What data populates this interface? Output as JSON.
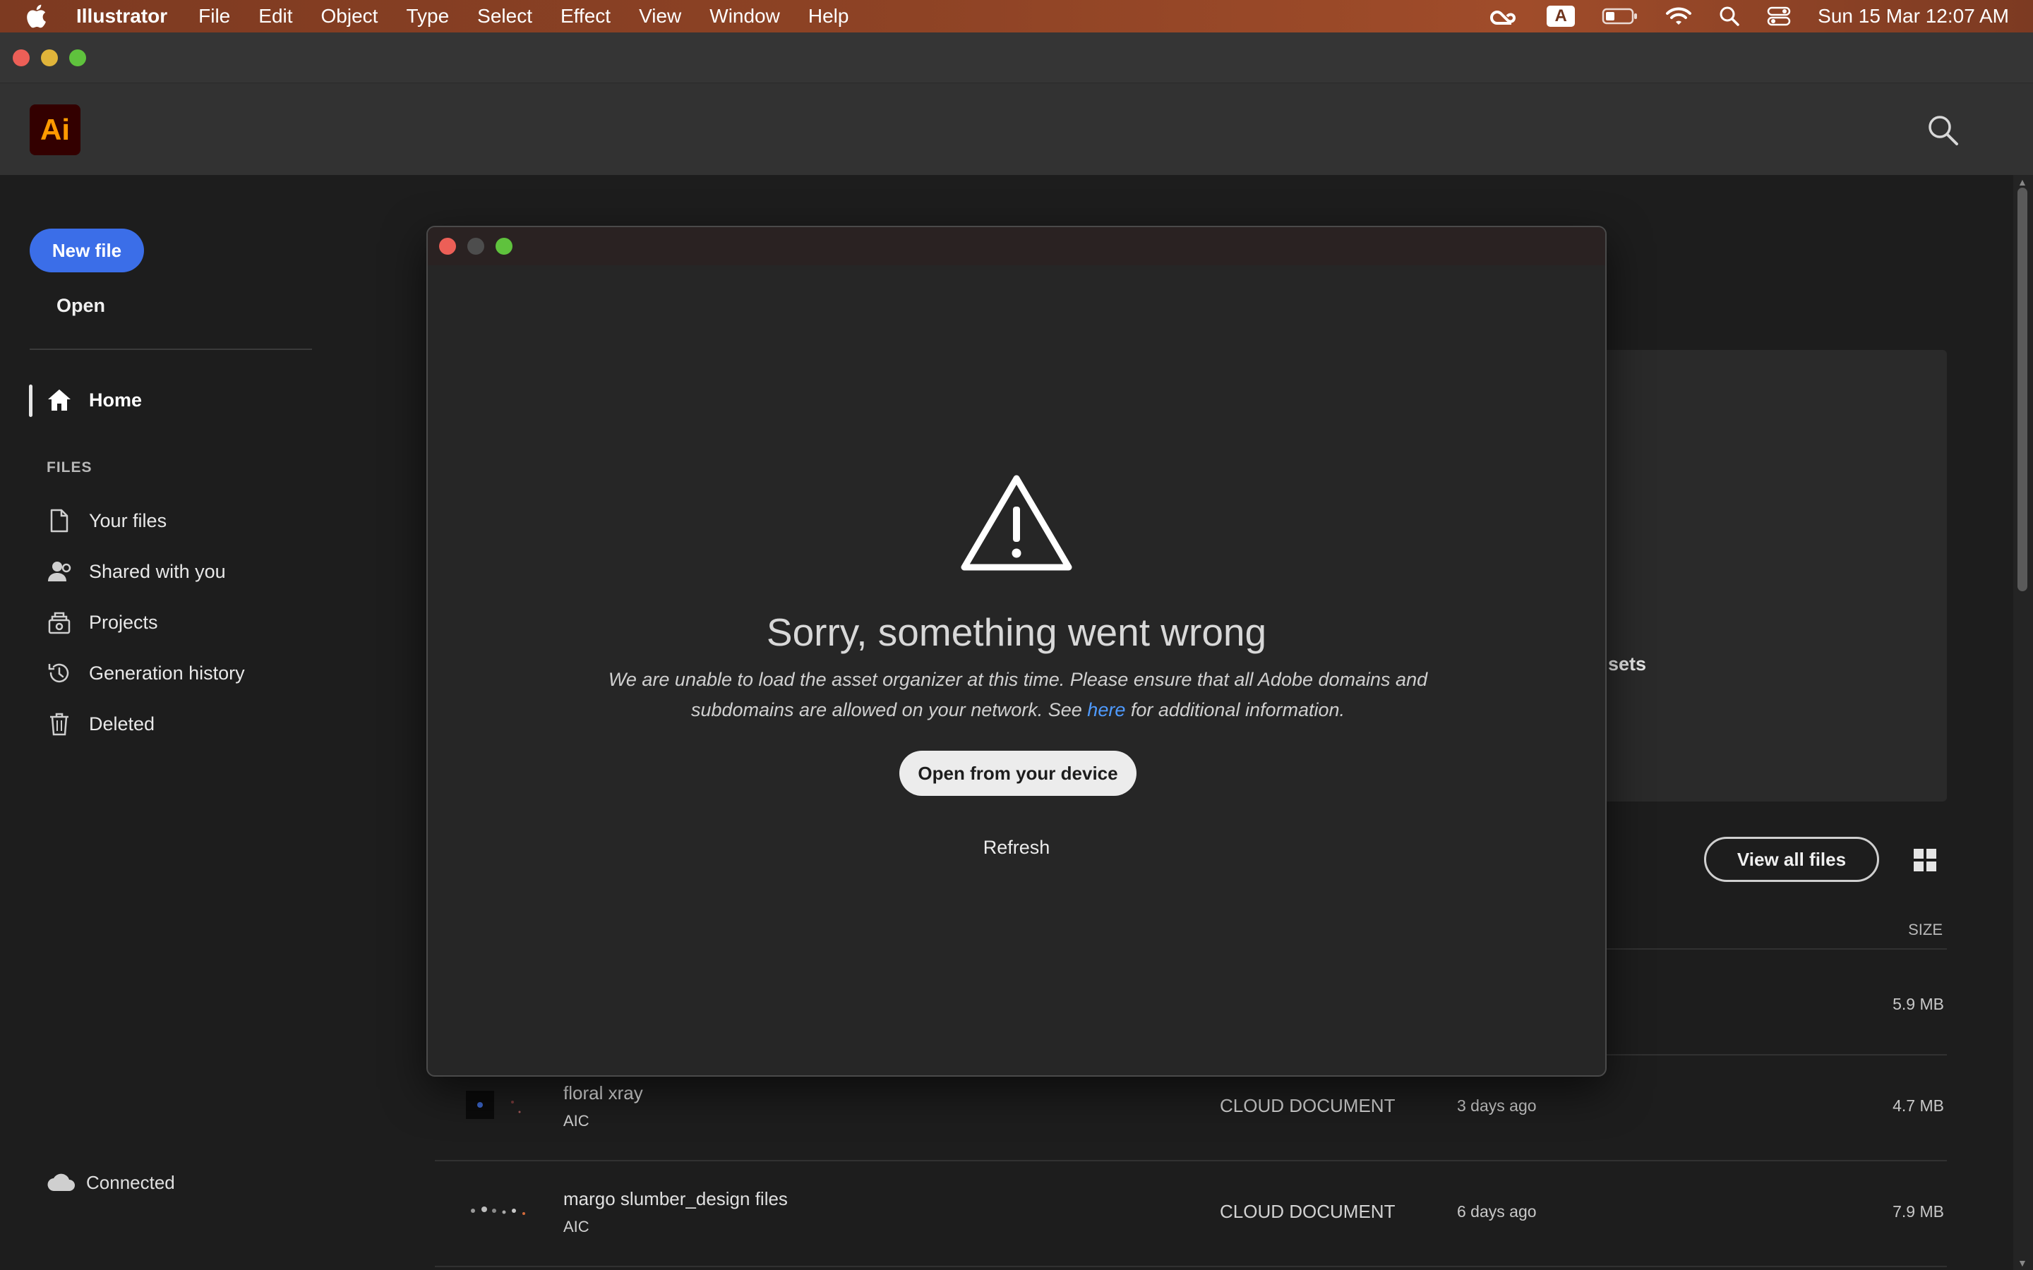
{
  "menubar": {
    "app_name": "Illustrator",
    "items": [
      "File",
      "Edit",
      "Object",
      "Type",
      "Select",
      "Effect",
      "View",
      "Window",
      "Help"
    ],
    "input_source": "A",
    "datetime": "Sun 15 Mar  12:07 AM"
  },
  "app": {
    "logo_text": "Ai",
    "brand_color": "#ff9a00",
    "accent_color": "#3b6ee8"
  },
  "sidebar": {
    "new_file_label": "New file",
    "open_label": "Open",
    "home_label": "Home",
    "files_heading": "FILES",
    "items": [
      {
        "label": "Your files",
        "icon": "document-icon"
      },
      {
        "label": "Shared with you",
        "icon": "shared-user-icon"
      },
      {
        "label": "Projects",
        "icon": "projects-icon"
      },
      {
        "label": "Generation history",
        "icon": "history-icon"
      },
      {
        "label": "Deleted",
        "icon": "trash-icon"
      }
    ],
    "status_label": "Connected"
  },
  "main": {
    "banner_glimpse": "sets",
    "banner_paren": ")",
    "view_all_label": "View all files",
    "size_column": "SIZE",
    "top_row_size": "5.9 MB",
    "files": [
      {
        "name": "floral xray",
        "type": "AIC",
        "kind": "CLOUD DOCUMENT",
        "modified": "3 days ago",
        "size": "4.7 MB"
      },
      {
        "name": "margo slumber_design files",
        "type": "AIC",
        "kind": "CLOUD DOCUMENT",
        "modified": "6 days ago",
        "size": "7.9 MB"
      }
    ]
  },
  "dialog": {
    "title": "Sorry, something went wrong",
    "message_part1": "We are unable to load the asset organizer at this time. Please ensure that all Adobe domains and subdomains are allowed on your network. See ",
    "message_link": "here",
    "message_part2": " for additional information.",
    "primary_button": "Open from your device",
    "secondary_button": "Refresh",
    "link_color": "#4f9bff"
  }
}
